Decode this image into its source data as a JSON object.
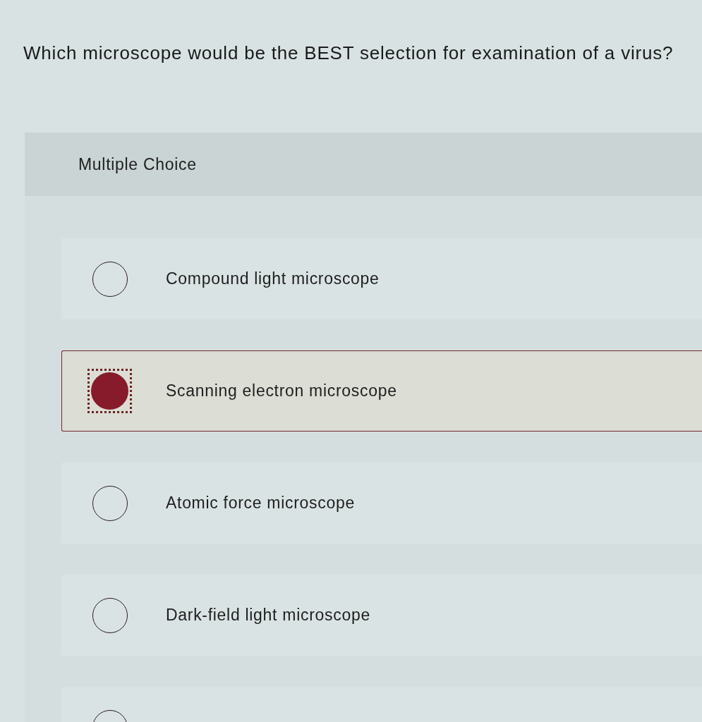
{
  "question": "Which microscope would be the BEST selection for examination of a virus?",
  "panel": {
    "heading": "Multiple Choice"
  },
  "options": [
    {
      "label": "Compound light microscope",
      "selected": false
    },
    {
      "label": "Scanning electron microscope",
      "selected": true
    },
    {
      "label": "Atomic force microscope",
      "selected": false
    },
    {
      "label": "Dark-field light microscope",
      "selected": false
    },
    {
      "selected": false
    }
  ]
}
